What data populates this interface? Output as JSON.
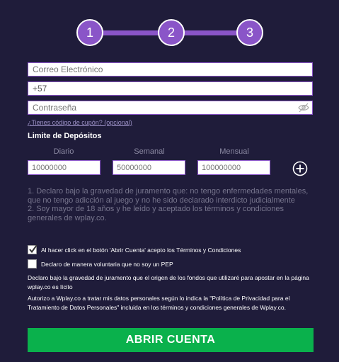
{
  "stepper": {
    "steps": [
      "1",
      "2",
      "3"
    ]
  },
  "form": {
    "email_placeholder": "Correo Electrónico",
    "phone_value": "+57",
    "password_placeholder": "Contraseña",
    "coupon_link": "¿Tienes código de cupón? (opcional)"
  },
  "deposits": {
    "title": "Limite de Depósitos",
    "columns": [
      {
        "label": "Diario",
        "value": "10000000"
      },
      {
        "label": "Semanal",
        "value": "50000000"
      },
      {
        "label": "Mensual",
        "value": "100000000"
      }
    ]
  },
  "declaration": {
    "line1": "1. Declaro bajo la gravedad de juramento que: no tengo enfermedades mentales, que no tengo adicción al juego y no he sido declarado interdicto judicialmente",
    "line2": "2. Soy mayor de 18 años y he leído y aceptado los términos y condiciones generales de wplay.co."
  },
  "checkboxes": {
    "terms": {
      "label": "Al hacer click en el botón 'Abrir Cuenta' acepto los Términos y Condiciones",
      "checked": true
    },
    "pep": {
      "label": "Declaro de manera voluntaria que no soy un PEP",
      "checked": false
    }
  },
  "legal": {
    "funds": "Declaro bajo la gravedad de juramento que el origen de los fondos que utilizaré para apostar en la página wplay.co es lícito",
    "privacy": "Autorizo a Wplay.co a tratar mis datos personales según lo indica la \"Política de Privacidad para el Tratamiento de Datos Personales\" incluida en los términos y condiciones generales de Wplay.co."
  },
  "submit_label": "ABRIR CUENTA",
  "colors": {
    "background": "#1f1c3a",
    "accent": "#8a55c8",
    "button": "#0ab14c"
  },
  "icons": [
    "eye-slash-icon",
    "plus-circle-icon",
    "checkmark-icon"
  ]
}
